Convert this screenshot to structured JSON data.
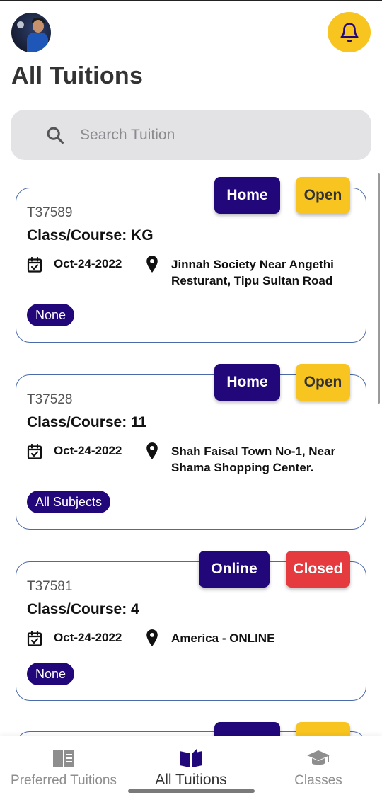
{
  "header": {
    "title": "All Tuitions",
    "bell_icon": "bell-icon"
  },
  "search": {
    "placeholder": "Search Tuition",
    "icon": "search-icon"
  },
  "cards": [
    {
      "mode": "Home",
      "status": "Open",
      "status_color": "#f8c41f",
      "code": "T37589",
      "course": "Class/Course: KG",
      "date": "Oct-24-2022",
      "address_line1": "Jinnah Society Near Angethi",
      "address_line2": "Resturant, Tipu Sultan Road",
      "subject": "None"
    },
    {
      "mode": "Home",
      "status": "Open",
      "status_color": "#f8c41f",
      "code": "T37528",
      "course": "Class/Course: 11",
      "date": "Oct-24-2022",
      "address_line1": "Shah Faisal Town No-1, Near",
      "address_line2": "Shama Shopping Center.",
      "subject": "All Subjects"
    },
    {
      "mode": "Online",
      "status": "Closed",
      "status_color": "#e53b3e",
      "code": "T37581",
      "course": "Class/Course: 4",
      "date": "Oct-24-2022",
      "address_line1": "America - ONLINE",
      "address_line2": "",
      "subject": "None"
    }
  ],
  "bottom_nav": [
    {
      "label": "Preferred Tuitions",
      "icon": "book-list-icon",
      "active": false
    },
    {
      "label": "All Tuitions",
      "icon": "open-book-icon",
      "active": true
    },
    {
      "label": "Classes",
      "icon": "graduation-cap-icon",
      "active": false
    }
  ],
  "colors": {
    "accent": "#21077a",
    "open": "#f8c41f",
    "closed": "#e53b3e",
    "card_border": "#4a6aa8"
  }
}
